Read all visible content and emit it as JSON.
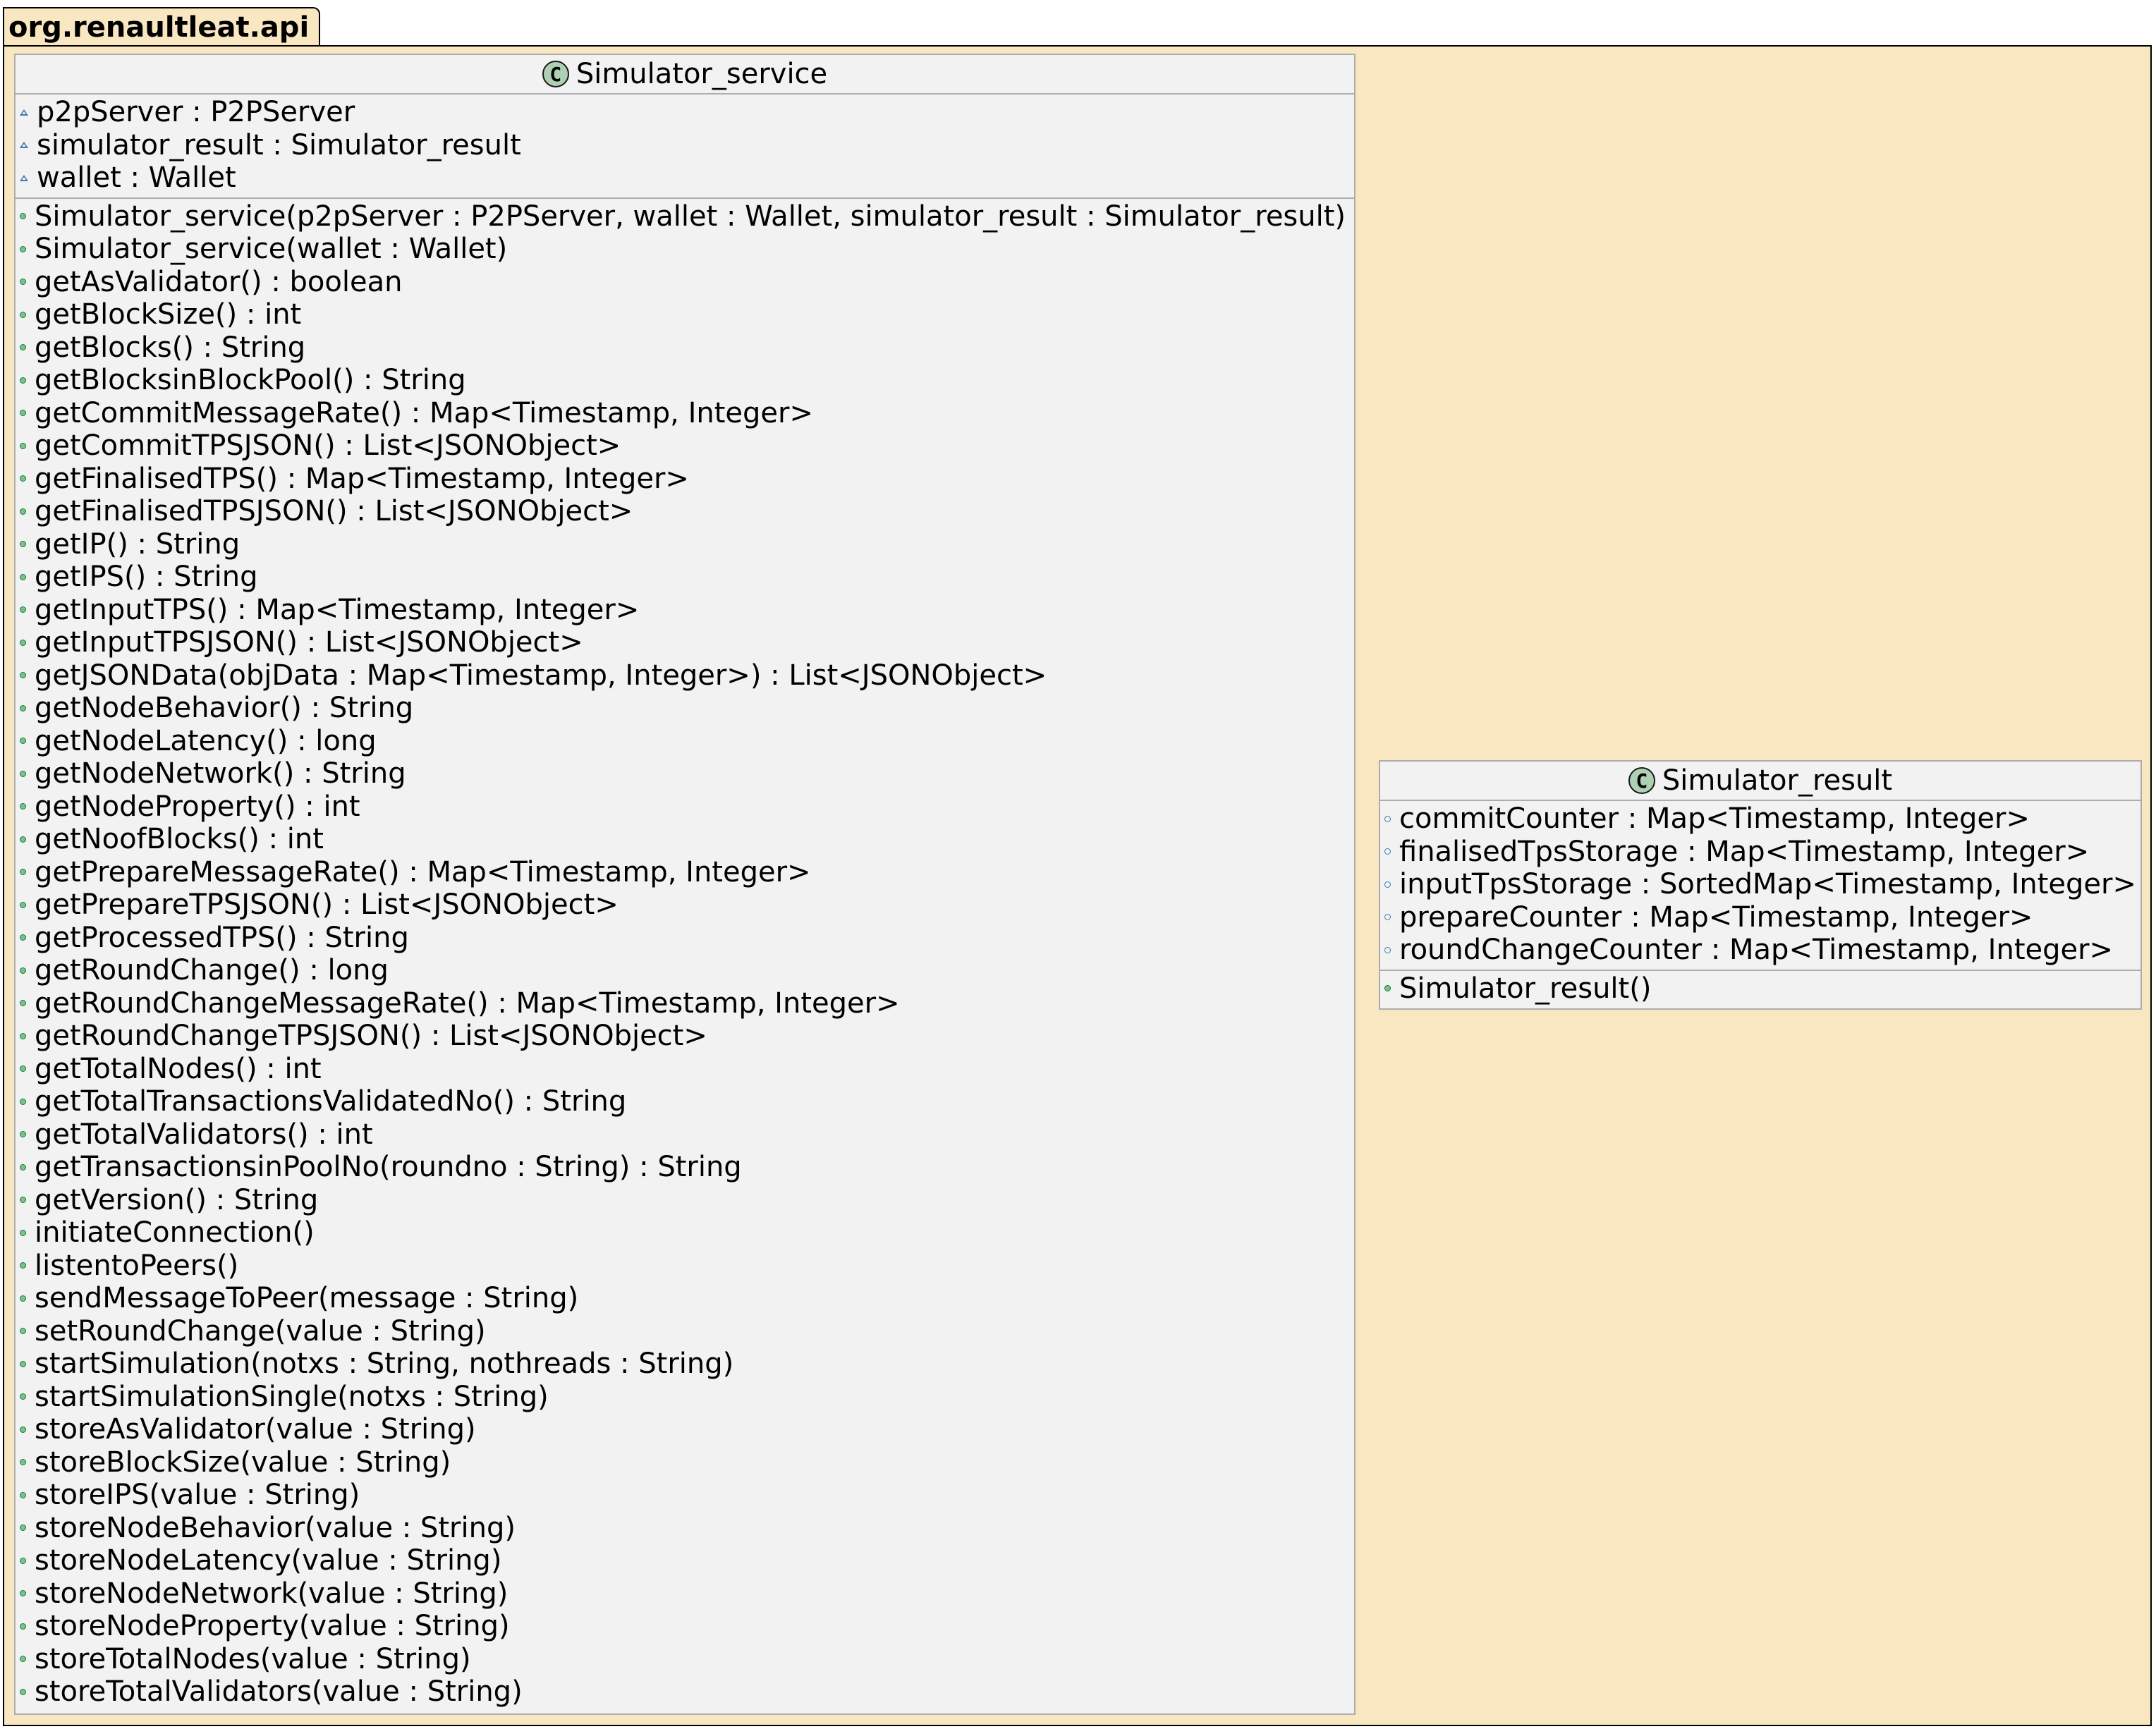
{
  "package": {
    "name": "org.renaultleat.api"
  },
  "classes": {
    "service": {
      "name": "Simulator_service",
      "icon_letter": "C",
      "attributes": [
        "p2pServer : P2PServer",
        "simulator_result : Simulator_result",
        "wallet : Wallet"
      ],
      "methods": [
        "Simulator_service(p2pServer : P2PServer, wallet : Wallet, simulator_result : Simulator_result)",
        "Simulator_service(wallet : Wallet)",
        "getAsValidator() : boolean",
        "getBlockSize() : int",
        "getBlocks() : String",
        "getBlocksinBlockPool() : String",
        "getCommitMessageRate() : Map<Timestamp, Integer>",
        "getCommitTPSJSON() : List<JSONObject>",
        "getFinalisedTPS() : Map<Timestamp, Integer>",
        "getFinalisedTPSJSON() : List<JSONObject>",
        "getIP() : String",
        "getIPS() : String",
        "getInputTPS() : Map<Timestamp, Integer>",
        "getInputTPSJSON() : List<JSONObject>",
        "getJSONData(objData : Map<Timestamp, Integer>) : List<JSONObject>",
        "getNodeBehavior() : String",
        "getNodeLatency() : long",
        "getNodeNetwork() : String",
        "getNodeProperty() : int",
        "getNoofBlocks() : int",
        "getPrepareMessageRate() : Map<Timestamp, Integer>",
        "getPrepareTPSJSON() : List<JSONObject>",
        "getProcessedTPS() : String",
        "getRoundChange() : long",
        "getRoundChangeMessageRate() : Map<Timestamp, Integer>",
        "getRoundChangeTPSJSON() : List<JSONObject>",
        "getTotalNodes() : int",
        "getTotalTransactionsValidatedNo() : String",
        "getTotalValidators() : int",
        "getTransactionsinPoolNo(roundno : String) : String",
        "getVersion() : String",
        "initiateConnection()",
        "listentoPeers()",
        "sendMessageToPeer(message : String)",
        "setRoundChange(value : String)",
        "startSimulation(notxs : String, nothreads : String)",
        "startSimulationSingle(notxs : String)",
        "storeAsValidator(value : String)",
        "storeBlockSize(value : String)",
        "storeIPS(value : String)",
        "storeNodeBehavior(value : String)",
        "storeNodeLatency(value : String)",
        "storeNodeNetwork(value : String)",
        "storeNodeProperty(value : String)",
        "storeTotalNodes(value : String)",
        "storeTotalValidators(value : String)"
      ]
    },
    "result": {
      "name": "Simulator_result",
      "icon_letter": "C",
      "attributes": [
        "commitCounter : Map<Timestamp, Integer>",
        "finalisedTpsStorage : Map<Timestamp, Integer>",
        "inputTpsStorage : SortedMap<Timestamp, Integer>",
        "prepareCounter : Map<Timestamp, Integer>",
        "roundChangeCounter : Map<Timestamp, Integer>"
      ],
      "methods": [
        "Simulator_result()"
      ]
    }
  },
  "colors": {
    "package_fill": "#f9e7c2",
    "class_fill": "#f2f2f2",
    "class_border": "#adadad",
    "class_icon": "#add1b2",
    "public_marker": "#84be84",
    "package_marker": "#4177af"
  }
}
